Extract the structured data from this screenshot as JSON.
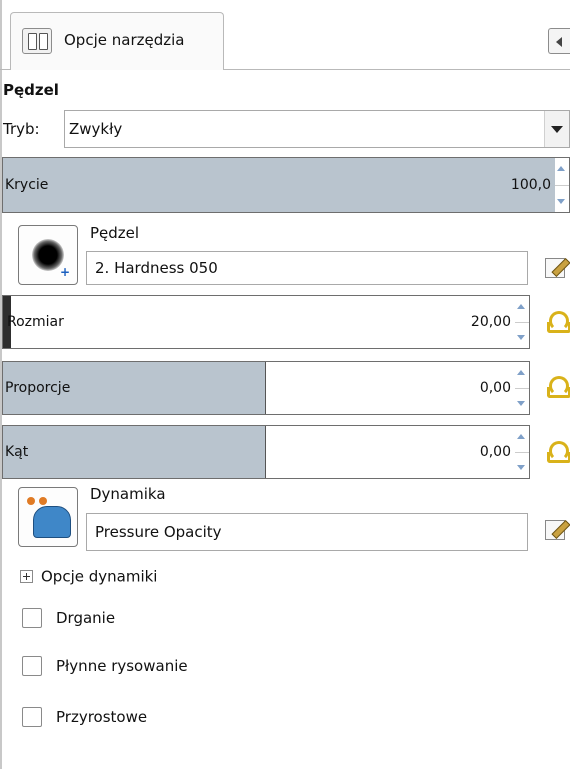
{
  "tab": {
    "label": "Opcje narzędzia",
    "icon": "tool-options-icon"
  },
  "section": {
    "title": "Pędzel"
  },
  "mode": {
    "label": "Tryb:",
    "value": "Zwykły"
  },
  "opacity": {
    "label": "Krycie",
    "value": "100,0",
    "fraction": 0.97
  },
  "brush": {
    "title": "Pędzel",
    "name": "2. Hardness 050"
  },
  "size": {
    "label": "Rozmiar",
    "value": "20,00"
  },
  "aspect": {
    "label": "Proporcje",
    "value": "0,00"
  },
  "angle": {
    "label": "Kąt",
    "value": "0,00"
  },
  "dynamics": {
    "title": "Dynamika",
    "name": "Pressure Opacity"
  },
  "dynamics_options": {
    "label": "Opcje dynamiki"
  },
  "checkboxes": {
    "jitter": {
      "label": "Drganie",
      "checked": false
    },
    "smooth": {
      "label": "Płynne rysowanie",
      "checked": false
    },
    "incremental": {
      "label": "Przyrostowe",
      "checked": false
    }
  },
  "colors": {
    "scale_fill": "#b9c4ce",
    "accent_icon": "#d9b21a"
  }
}
